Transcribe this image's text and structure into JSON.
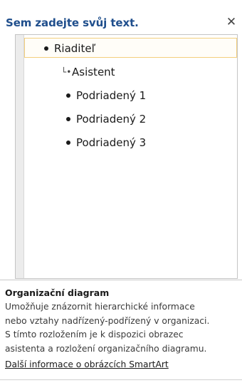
{
  "pane": {
    "title": "Sem zadejte svůj text.",
    "close_glyph": "✕",
    "close_icon": "close-icon"
  },
  "text_pane": {
    "items": [
      {
        "label": "Riaditeľ",
        "level": 1,
        "kind": "bullet",
        "selected": true
      },
      {
        "label": "Asistent",
        "level": 2,
        "kind": "assistant",
        "selected": false
      },
      {
        "label": "Podriadený 1",
        "level": 2,
        "kind": "bullet",
        "selected": false
      },
      {
        "label": "Podriadený 2",
        "level": 2,
        "kind": "bullet",
        "selected": false
      },
      {
        "label": "Podriadený 3",
        "level": 2,
        "kind": "bullet",
        "selected": false
      }
    ],
    "assistant_mark": "└•"
  },
  "description": {
    "title": "Organizační diagram",
    "lines": [
      "Umožňuje znázornit hierarchické informace",
      "nebo vztahy nadřízený-podřízený v organizaci.",
      "S tímto rozložením je k dispozici obrazec",
      "asistenta a rozložení organizačního diagramu."
    ],
    "link": "Další informace o obrázcích SmartArt"
  },
  "colors": {
    "title": "#1f4e8c",
    "selection_border": "#f3cf7d"
  }
}
